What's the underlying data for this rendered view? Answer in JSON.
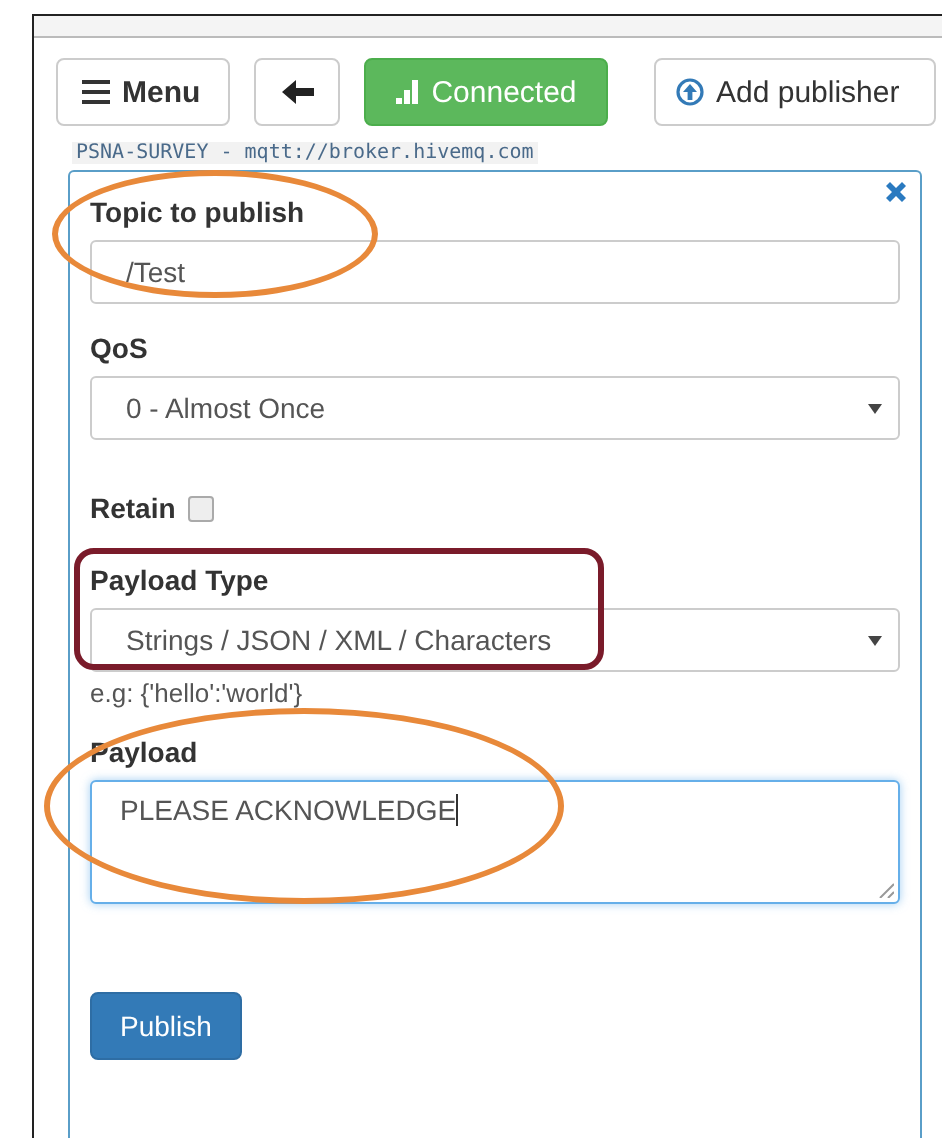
{
  "toolbar": {
    "buttons": [
      {
        "kind": "menu",
        "label": "Menu"
      },
      {
        "kind": "back"
      },
      {
        "kind": "status",
        "label": "Connected",
        "connected": true
      },
      {
        "kind": "add",
        "label": "Add publisher"
      }
    ]
  },
  "connection": "PSNA-SURVEY - mqtt://broker.hivemq.com",
  "publisher": {
    "fields": [
      {
        "kind": "text",
        "label": "Topic to publish",
        "value": "/Test",
        "highlight": {
          "kind": "ellipse",
          "color": "#e8893a"
        }
      },
      {
        "kind": "select",
        "label": "QoS",
        "value": "0 - Almost Once"
      },
      {
        "kind": "checkbox",
        "label": "Retain",
        "checked": false
      },
      {
        "kind": "select",
        "label": "Payload Type",
        "value": "Strings / JSON / XML / Characters",
        "hint": "e.g: {'hello':'world'}",
        "highlight": {
          "kind": "box",
          "color": "#7a1b2a"
        }
      },
      {
        "kind": "textarea",
        "label": "Payload",
        "value": "PLEASE ACKNOWLEDGE",
        "focused": true,
        "highlight": {
          "kind": "ellipse",
          "color": "#e8893a"
        }
      }
    ],
    "submit": "Publish"
  }
}
